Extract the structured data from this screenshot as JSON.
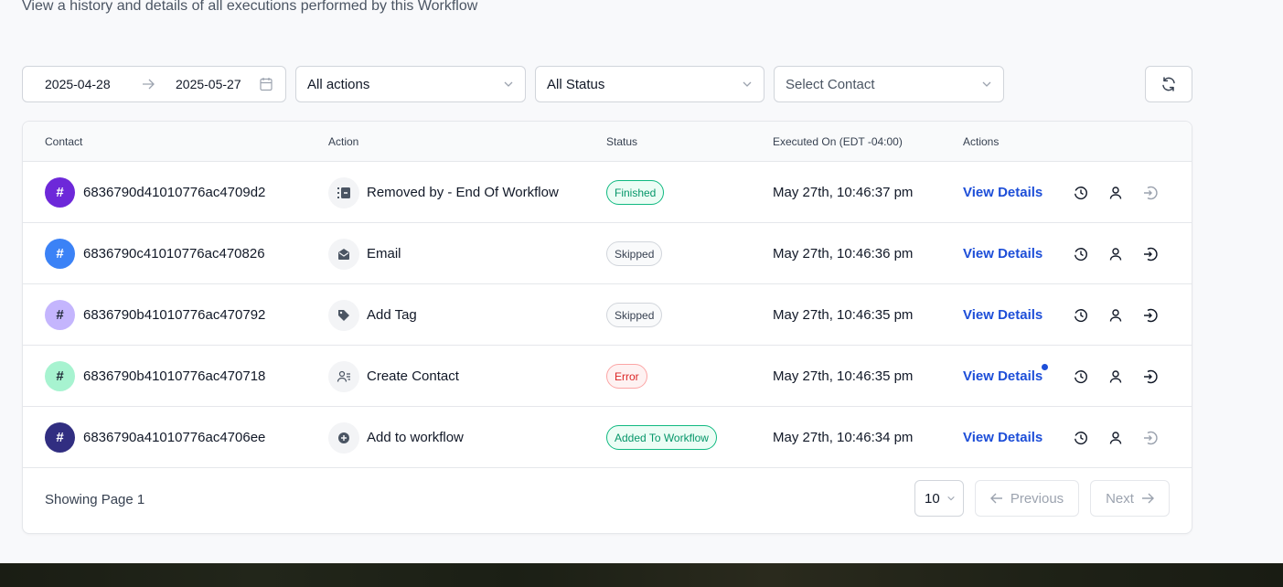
{
  "page": {
    "subtitle": "View a history and details of all executions performed by this Workflow"
  },
  "filters": {
    "date_start": "2025-04-28",
    "date_end": "2025-05-27",
    "actions_value": "All actions",
    "status_value": "All Status",
    "contact_placeholder": "Select Contact"
  },
  "table": {
    "headers": {
      "contact": "Contact",
      "action": "Action",
      "status": "Status",
      "executed_on": "Executed On (EDT -04:00)",
      "actions": "Actions"
    },
    "rows": [
      {
        "avatar_symbol": "#",
        "avatar_color": "#6d28d9",
        "contact_id": "6836790d41010776ac4709d2",
        "action_icon": "remove-icon",
        "action": "Removed by  -  End Of Workflow",
        "status": "Finished",
        "executed_on": "May 27th, 10:46:37 pm",
        "view_details": "View Details",
        "has_dot": false,
        "enter_disabled": true
      },
      {
        "avatar_symbol": "#",
        "avatar_color": "#3b82f6",
        "contact_id": "6836790c41010776ac470826",
        "action_icon": "email-icon",
        "action": "Email",
        "status": "Skipped",
        "executed_on": "May 27th, 10:46:36 pm",
        "view_details": "View Details",
        "has_dot": false,
        "enter_disabled": false
      },
      {
        "avatar_symbol": "#",
        "avatar_color": "#c4b5fd",
        "contact_id": "6836790b41010776ac470792",
        "action_icon": "tag-icon",
        "action": "Add Tag",
        "status": "Skipped",
        "executed_on": "May 27th, 10:46:35 pm",
        "view_details": "View Details",
        "has_dot": false,
        "enter_disabled": false
      },
      {
        "avatar_symbol": "#",
        "avatar_color": "#a7f3d0",
        "contact_id": "6836790b41010776ac470718",
        "action_icon": "create-contact-icon",
        "action": "Create Contact",
        "status": "Error",
        "executed_on": "May 27th, 10:46:35 pm",
        "view_details": "View Details",
        "has_dot": true,
        "enter_disabled": false
      },
      {
        "avatar_symbol": "#",
        "avatar_color": "#312e81",
        "contact_id": "6836790a41010776ac4706ee",
        "action_icon": "add-workflow-icon",
        "action": "Add to workflow",
        "status": "Added To Workflow",
        "executed_on": "May 27th, 10:46:34 pm",
        "view_details": "View Details",
        "has_dot": false,
        "enter_disabled": true
      }
    ]
  },
  "footer": {
    "showing": "Showing Page 1",
    "page_size": "10",
    "previous": "Previous",
    "next": "Next"
  },
  "colors": {
    "link": "#1d4ed8",
    "finished": "#059669",
    "error": "#dc2626"
  }
}
